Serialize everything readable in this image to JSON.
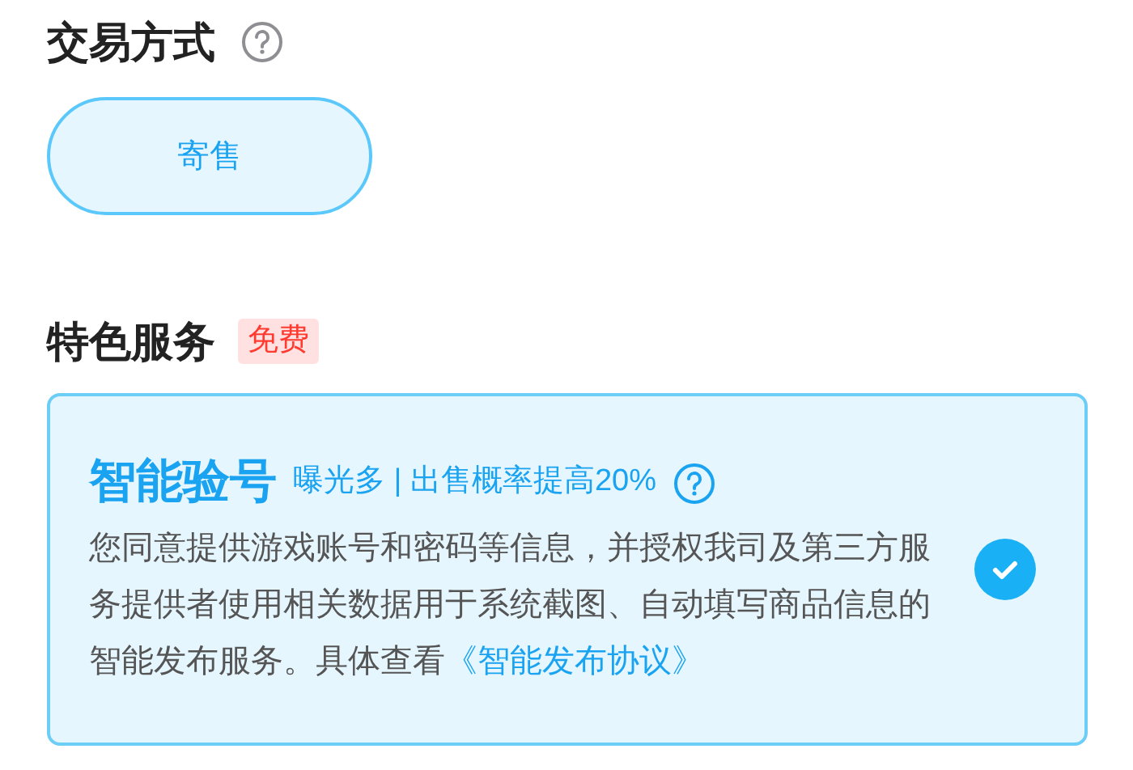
{
  "trade_method": {
    "title": "交易方式",
    "options": [
      {
        "label": "寄售",
        "selected": true
      }
    ]
  },
  "special_services": {
    "title": "特色服务",
    "badge": "免费",
    "services": [
      {
        "title": "智能验号",
        "tagline": "曝光多 | 出售概率提高20%",
        "body": "您同意提供游戏账号和密码等信息，并授权我司及第三方服务提供者使用相关数据用于系统截图、自动填写商品信息的智能发布服务。具体查看",
        "link": "《智能发布协议》",
        "checked": true
      }
    ]
  }
}
